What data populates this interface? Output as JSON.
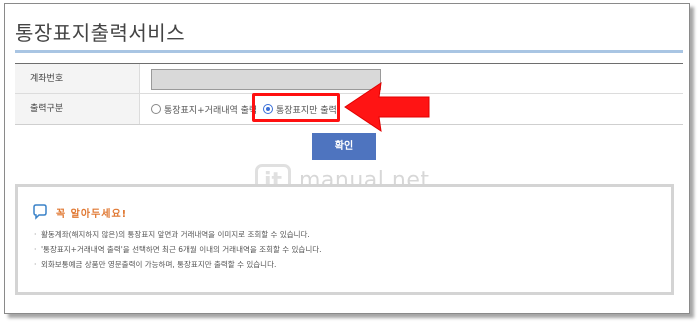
{
  "page": {
    "title": "통장표지출력서비스"
  },
  "form": {
    "account_label": "계좌번호",
    "account_value": "",
    "output_type_label": "출력구분",
    "options": [
      {
        "label": "통장표지+거래내역 출력",
        "checked": false
      },
      {
        "label": "통장표지만 출력",
        "checked": true
      }
    ]
  },
  "actions": {
    "confirm_label": "확인"
  },
  "watermark": {
    "mark": "it",
    "text": "manual.net"
  },
  "notice": {
    "title": "꼭 알아두세요!",
    "items": [
      "활동계좌(해지하지 않은)의 통장표지 앞면과 거래내역을 이미지로 조회할 수 있습니다.",
      "'통장표지+거래내역 출력'을 선택하면 최근 6개월 이내의 거래내역을 조회할 수 있습니다.",
      "외화보통예금 상품만 영문출력이 가능하며, 통장표지만 출력할 수 있습니다."
    ]
  },
  "colors": {
    "accent_blue": "#4e74bf",
    "highlight_red": "#ff1010",
    "notice_orange": "#e07832",
    "title_rule": "#a9c5e3"
  },
  "icons": {
    "notice": "speech-bubble-icon",
    "annotation": "red-arrow-icon"
  }
}
